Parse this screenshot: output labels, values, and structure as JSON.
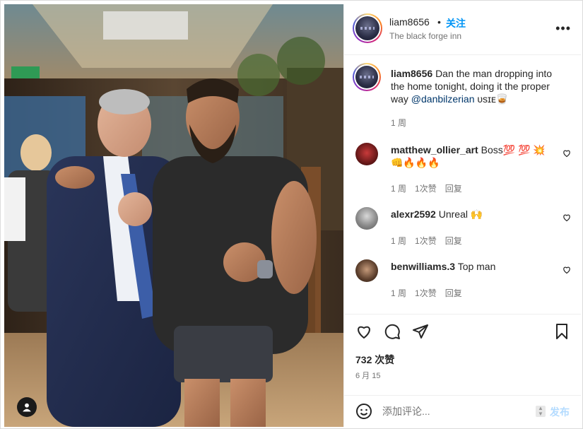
{
  "post": {
    "username": "liam8656",
    "follow_label": "关注",
    "dot": "•",
    "location": "The black forge inn",
    "more_label": "•••"
  },
  "caption": {
    "username": "liam8656",
    "text_before": "Dan the man dropping into the home tonight, doing it the proper way ",
    "mention": "@danbilzerian",
    "text_after": " ᴜsɪᴇ🥃",
    "time": "1 周"
  },
  "comments": [
    {
      "username": "matthew_ollier_art",
      "text": "Boss💯 💯 💥 👊🔥🔥🔥",
      "time": "1 周",
      "likes": "1次赞",
      "reply": "回复"
    },
    {
      "username": "alexr2592",
      "text": "Unreal 🙌",
      "time": "1 周",
      "likes": "1次赞",
      "reply": "回复"
    },
    {
      "username": "benwilliams.3",
      "text": "Top man",
      "time": "1 周",
      "likes": "1次赞",
      "reply": "回复"
    }
  ],
  "actions": {
    "likes_count": "732 次赞",
    "date": "6 月 15"
  },
  "compose": {
    "placeholder": "添加评论...",
    "post_label": "发布"
  },
  "colors": {
    "accent": "#0095f6",
    "text": "#262626",
    "muted": "#737373",
    "post_disabled": "#b3dbff"
  }
}
